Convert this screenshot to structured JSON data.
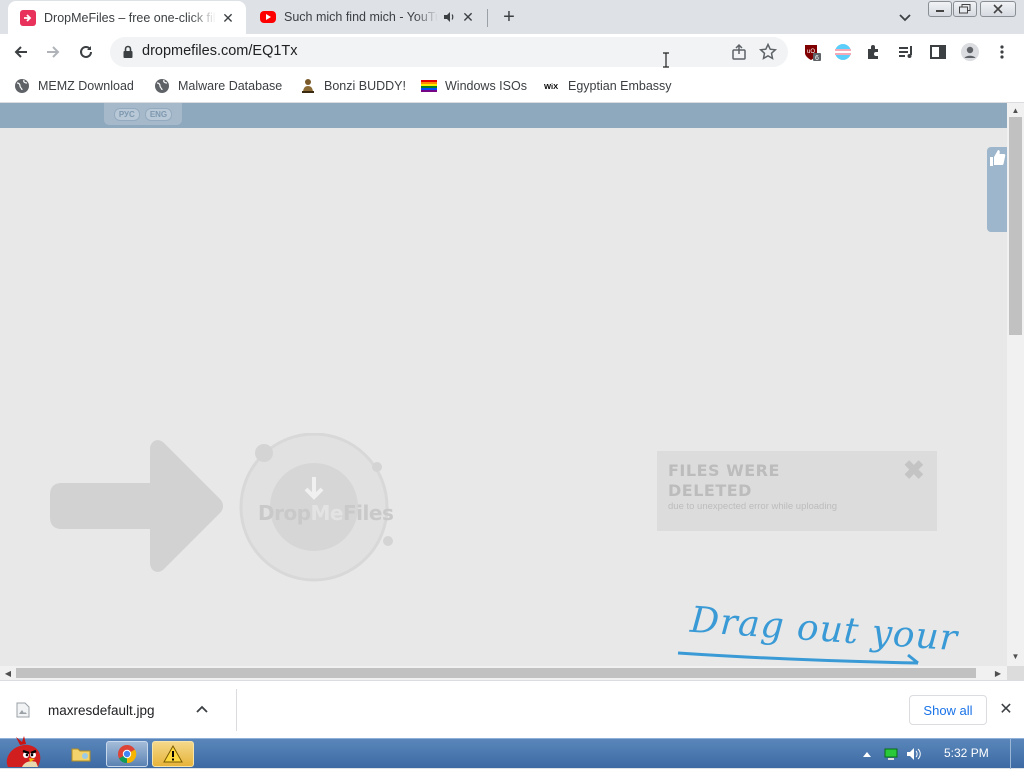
{
  "browser": {
    "tabs": [
      {
        "title": "DropMeFiles – free one-click file sharing",
        "active": true,
        "favicon": "dropmefiles-icon",
        "color": "#e8315b"
      },
      {
        "title": "Such mich find mich - YouTube",
        "active": false,
        "favicon": "youtube-icon",
        "audio": true,
        "color": "#ff0000"
      }
    ],
    "new_tab_label": "+",
    "address": {
      "url": "dropmefiles.com/EQ1Tx"
    },
    "extensions": [
      {
        "name": "ublock-icon",
        "badge": "6",
        "color": "#800000"
      },
      {
        "name": "trans-flag-icon"
      },
      {
        "name": "puzzle-icon"
      },
      {
        "name": "media-control-icon"
      },
      {
        "name": "side-panel-icon"
      },
      {
        "name": "profile-icon"
      },
      {
        "name": "menu-icon"
      }
    ]
  },
  "bookmarks": [
    {
      "label": "MEMZ Download",
      "icon": "globe-icon"
    },
    {
      "label": "Malware Database",
      "icon": "globe-icon"
    },
    {
      "label": "Bonzi BUDDY!",
      "icon": "bonzi-icon"
    },
    {
      "label": "Windows ISOs",
      "icon": "rainbow-flag-icon"
    },
    {
      "label": "Egyptian Embassy",
      "icon": "wix-icon",
      "icon_text": "WiX"
    }
  ],
  "page": {
    "lang": {
      "ru": "РУС",
      "en": "ENG"
    },
    "logo": {
      "drop": "Drop",
      "me": "Me",
      "files": "Files"
    },
    "notice": {
      "title_line1": "FILES WERE",
      "title_line2": "DELETED",
      "subtitle": "due to unexpected error while uploading",
      "close": "✖"
    },
    "drag_text": "Drag out your"
  },
  "downloads": {
    "file_name": "maxresdefault.jpg",
    "show_all": "Show all"
  },
  "taskbar": {
    "clock": "5:32 PM"
  },
  "colors": {
    "site_header": "#8ea8be",
    "page_bg": "#e8e8e8",
    "drag_text": "#3a9ad6",
    "link_blue": "#1a73e8"
  }
}
